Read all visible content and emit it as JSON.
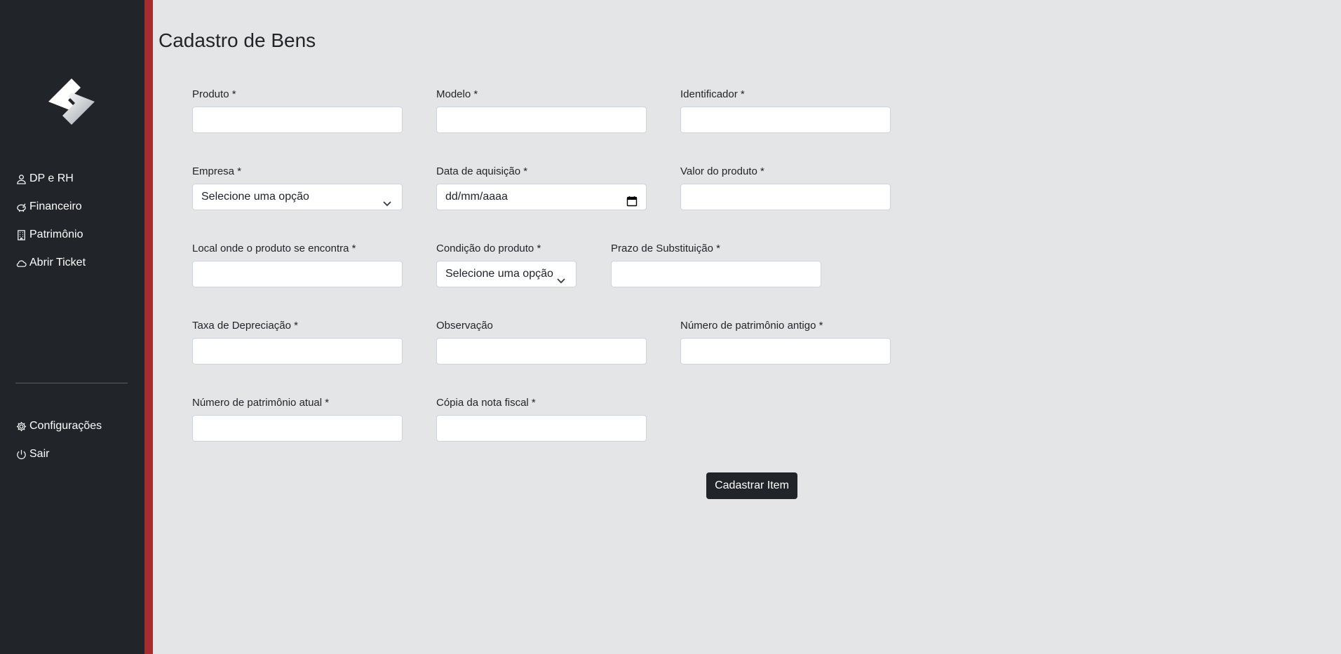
{
  "sidebar": {
    "nav_items": [
      {
        "label": "DP e RH",
        "icon": "person-icon"
      },
      {
        "label": "Financeiro",
        "icon": "piggy-bank-icon"
      },
      {
        "label": "Patrimônio",
        "icon": "building-icon"
      },
      {
        "label": "Abrir Ticket",
        "icon": "cloud-icon"
      }
    ],
    "bottom_items": [
      {
        "label": "Configurações",
        "icon": "gear-icon"
      },
      {
        "label": "Sair",
        "icon": "power-icon"
      }
    ]
  },
  "page": {
    "title": "Cadastro de Bens"
  },
  "form": {
    "produto": {
      "label": "Produto *",
      "value": ""
    },
    "modelo": {
      "label": "Modelo *",
      "value": ""
    },
    "identificador": {
      "label": "Identificador *",
      "value": ""
    },
    "empresa": {
      "label": "Empresa *",
      "selected": "Selecione uma opção"
    },
    "data_aquisicao": {
      "label": "Data de aquisição *",
      "placeholder": "dd/mm/aaaa"
    },
    "valor_produto": {
      "label": "Valor do produto *",
      "value": ""
    },
    "local": {
      "label": "Local onde o produto se encontra *",
      "value": ""
    },
    "condicao": {
      "label": "Condição do produto *",
      "selected": "Selecione uma opção"
    },
    "prazo": {
      "label": "Prazo de Substituição *",
      "value": ""
    },
    "taxa": {
      "label": "Taxa de Depreciação *",
      "value": ""
    },
    "observacao": {
      "label": "Observação",
      "value": ""
    },
    "patrimonio_antigo": {
      "label": "Número de patrimônio antigo *",
      "value": ""
    },
    "patrimonio_atual": {
      "label": "Número de patrimônio atual *",
      "value": ""
    },
    "nota_fiscal": {
      "label": "Cópia da nota fiscal *",
      "value": ""
    },
    "submit_label": "Cadastrar Item"
  },
  "colors": {
    "sidebar": "#212529",
    "accent": "#a72b2f",
    "background": "#e4e5e6"
  }
}
